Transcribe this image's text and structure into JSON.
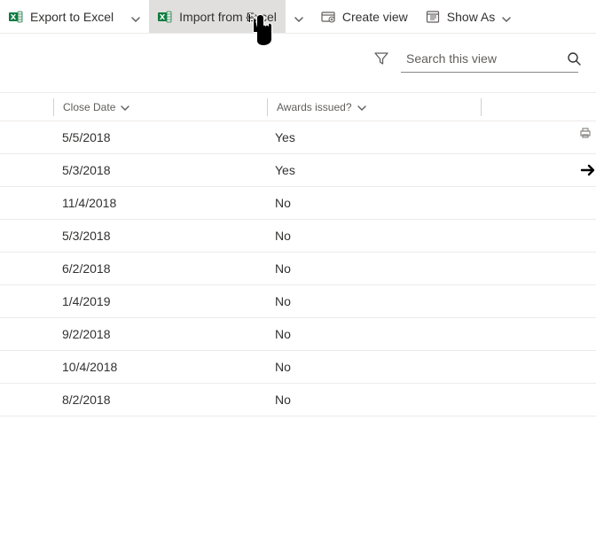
{
  "commands": {
    "export": "Export to Excel",
    "import": "Import from Excel",
    "createView": "Create view",
    "showAs": "Show As"
  },
  "search": {
    "placeholder": "Search this view"
  },
  "columns": {
    "closeDate": "Close Date",
    "awardsIssued": "Awards issued?"
  },
  "rows": [
    {
      "closeDate": "5/5/2018",
      "awards": "Yes"
    },
    {
      "closeDate": "5/3/2018",
      "awards": "Yes"
    },
    {
      "closeDate": "11/4/2018",
      "awards": "No"
    },
    {
      "closeDate": "5/3/2018",
      "awards": "No"
    },
    {
      "closeDate": "6/2/2018",
      "awards": "No"
    },
    {
      "closeDate": "1/4/2019",
      "awards": "No"
    },
    {
      "closeDate": "9/2/2018",
      "awards": "No"
    },
    {
      "closeDate": "10/4/2018",
      "awards": "No"
    },
    {
      "closeDate": "8/2/2018",
      "awards": "No"
    }
  ]
}
